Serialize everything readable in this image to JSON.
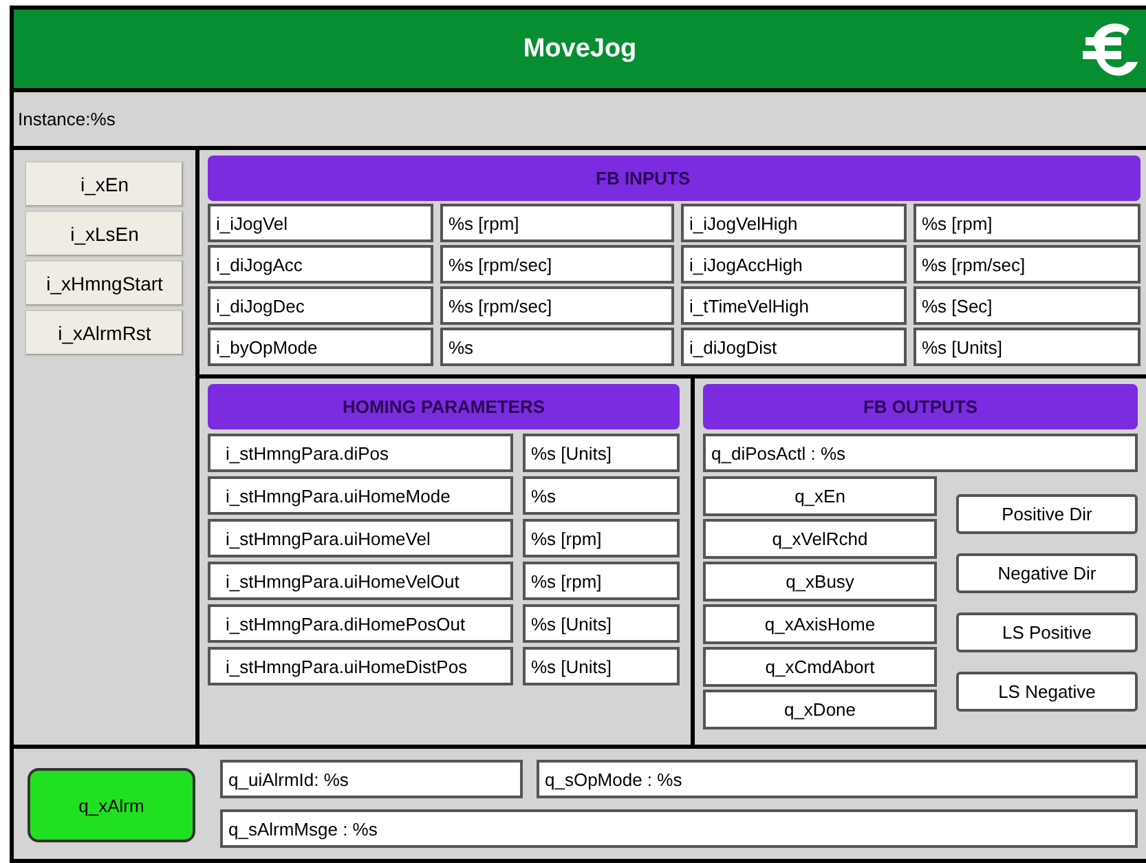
{
  "window": {
    "title": "MoveJog"
  },
  "instance": {
    "label": "Instance:%s"
  },
  "input_buttons": [
    "i_xEn",
    "i_xLsEn",
    "i_xHmngStart",
    "i_xAlrmRst"
  ],
  "fb_inputs": {
    "title": "FB INPUTS",
    "rows": [
      {
        "name": "i_iJogVel",
        "value": "%s [rpm]",
        "name_2": "i_iJogVelHigh",
        "value_2": "%s [rpm]"
      },
      {
        "name": "i_diJogAcc",
        "value": "%s [rpm/sec]",
        "name_2": "i_iJogAccHigh",
        "value_2": "%s [rpm/sec]"
      },
      {
        "name": "i_diJogDec",
        "value": "%s [rpm/sec]",
        "name_2": "i_tTimeVelHigh",
        "value_2": "%s [Sec]"
      },
      {
        "name": "i_byOpMode",
        "value": "%s",
        "name_2": "i_diJogDist",
        "value_2": "%s [Units]"
      }
    ]
  },
  "homing_parameters": {
    "title": "HOMING PARAMETERS",
    "rows": [
      {
        "name": "i_stHmngPara.diPos",
        "value": "%s [Units]"
      },
      {
        "name": "i_stHmngPara.uiHomeMode",
        "value": "%s"
      },
      {
        "name": "i_stHmngPara.uiHomeVel",
        "value": "%s [rpm]"
      },
      {
        "name": "i_stHmngPara.uiHomeVelOut",
        "value": "%s [rpm]"
      },
      {
        "name": "i_stHmngPara.diHomePosOut",
        "value": "%s [Units]"
      },
      {
        "name": "i_stHmngPara.uiHomeDistPos",
        "value": "%s [Units]"
      }
    ]
  },
  "fb_outputs": {
    "title": "FB OUTPUTS",
    "position": "q_diPosActl : %s",
    "lamps": [
      {
        "label": "q_xEn",
        "on": false
      },
      {
        "label": "q_xVelRchd",
        "on": false
      },
      {
        "label": "q_xBusy",
        "on": false
      },
      {
        "label": "q_xAxisHome",
        "on": false
      },
      {
        "label": "q_xCmdAbort",
        "on": false
      },
      {
        "label": "q_xDone",
        "on": false
      }
    ],
    "indicators": [
      {
        "label": "Positive Dir",
        "on": false
      },
      {
        "label": "Negative Dir",
        "on": false
      },
      {
        "label": "LS Positive",
        "on": false
      },
      {
        "label": "LS Negative",
        "on": false
      }
    ]
  },
  "status": {
    "alarm": {
      "label": "q_xAlrm",
      "on": true
    },
    "alarm_id": "q_uiAlrmId: %s",
    "op_mode": "q_sOpMode : %s",
    "alarm_message": "q_sAlrmMsge : %s"
  }
}
